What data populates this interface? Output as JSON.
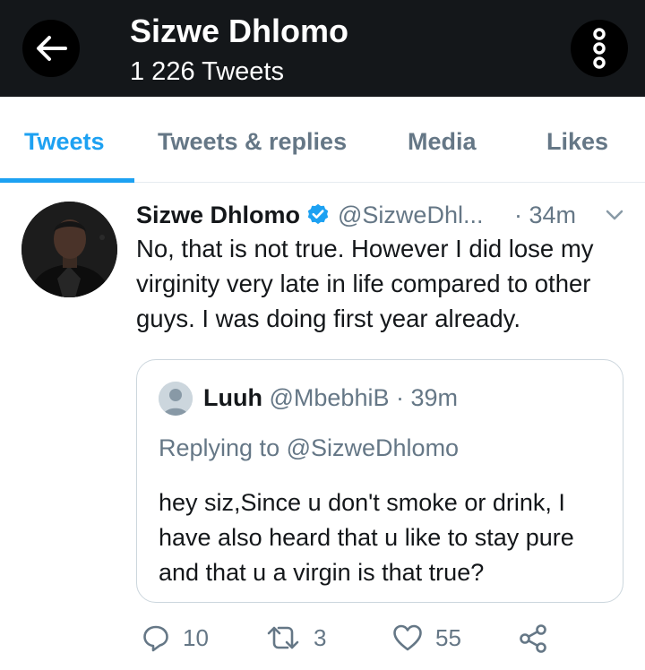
{
  "header": {
    "name": "Sizwe Dhlomo",
    "tweet_count": "1 226 Tweets"
  },
  "tabs": [
    {
      "label": "Tweets",
      "active": true
    },
    {
      "label": "Tweets & replies",
      "active": false
    },
    {
      "label": "Media",
      "active": false
    },
    {
      "label": "Likes",
      "active": false
    }
  ],
  "tweet": {
    "author_name": "Sizwe Dhlomo",
    "handle": "@SizweDhl...",
    "time": "· 34m",
    "text": "No, that is not true. However I did lose my virginity very late in life compared to other guys. I was doing first year already.",
    "quoted": {
      "author_name": "Luuh",
      "handle": "@MbebhiB",
      "time": "· 39m",
      "replying_prefix": "Replying to",
      "replying_to": "@SizweDhlomo",
      "text": "hey siz,Since u don't smoke or drink, I have also heard that u like to stay pure and that u a virgin is that true?"
    },
    "actions": {
      "replies": "10",
      "retweets": "3",
      "likes": "55"
    }
  },
  "colors": {
    "accent": "#1da1f2",
    "header_bg": "#14171a",
    "muted_text": "#657786",
    "border": "#ccd6dd"
  },
  "icons": {
    "back": "arrow-left-icon",
    "more": "more-vertical-icon",
    "verified": "verified-badge-icon",
    "caret": "chevron-down-icon",
    "reply": "reply-icon",
    "retweet": "retweet-icon",
    "like": "heart-icon",
    "share": "share-icon"
  }
}
